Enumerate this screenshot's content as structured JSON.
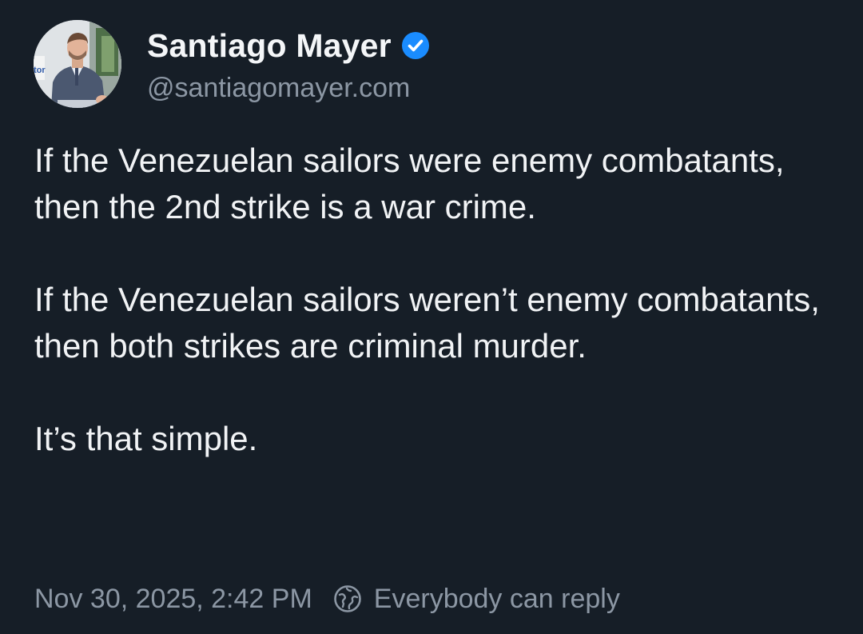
{
  "author": {
    "display_name": "Santiago Mayer",
    "handle": "@santiagomayer.com",
    "verified": true,
    "avatar_text": "tor"
  },
  "post": {
    "paragraphs": [
      "If the Venezuelan sailors were enemy combatants, then the 2nd strike is a war crime.",
      "If the Venezuelan sailors weren’t enemy combatants, then both strikes are criminal murder.",
      "It’s that simple."
    ],
    "timestamp": "Nov 30, 2025, 2:42 PM",
    "reply_setting": "Everybody can reply"
  },
  "icons": {
    "verified": "verified-badge-icon",
    "reply_setting": "globe-icon"
  },
  "colors": {
    "background": "#161e27",
    "text": "#f1f3f5",
    "muted": "#8c97a4",
    "verified_blue": "#1a8cff"
  }
}
